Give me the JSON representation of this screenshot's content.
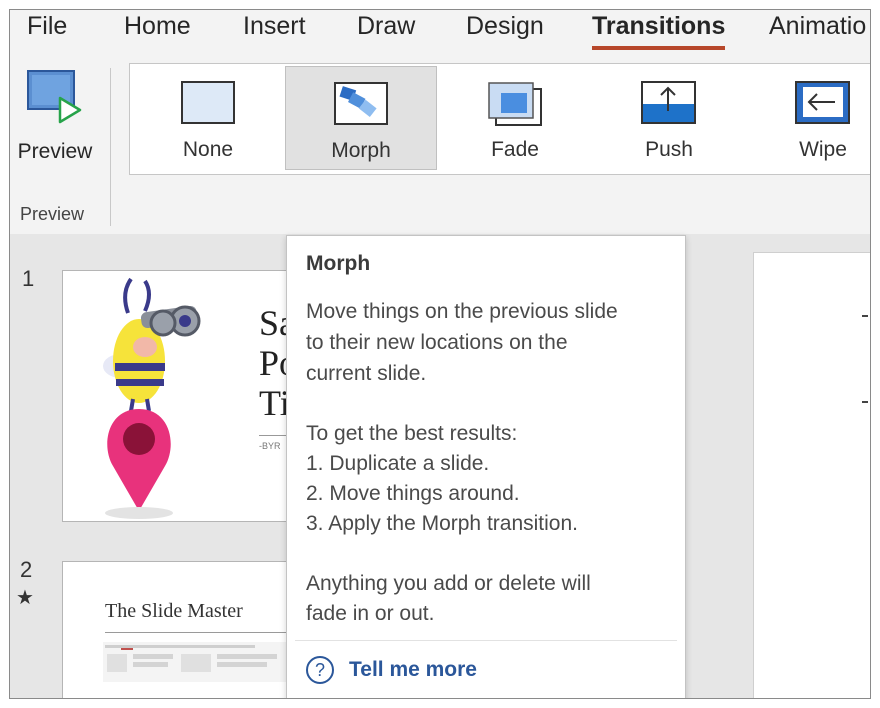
{
  "tabs": [
    {
      "label": "File",
      "active": false
    },
    {
      "label": "Home",
      "active": false
    },
    {
      "label": "Insert",
      "active": false
    },
    {
      "label": "Draw",
      "active": false
    },
    {
      "label": "Design",
      "active": false
    },
    {
      "label": "Transitions",
      "active": true
    },
    {
      "label": "Animatio",
      "active": false
    }
  ],
  "ribbon": {
    "preview_label": "Preview",
    "preview_group_label": "Preview",
    "transitions": [
      {
        "label": "None",
        "icon": "none-transition-icon",
        "selected": false
      },
      {
        "label": "Morph",
        "icon": "morph-transition-icon",
        "selected": true
      },
      {
        "label": "Fade",
        "icon": "fade-transition-icon",
        "selected": false
      },
      {
        "label": "Push",
        "icon": "push-transition-icon",
        "selected": false
      },
      {
        "label": "Wipe",
        "icon": "wipe-transition-icon",
        "selected": false
      }
    ]
  },
  "slides": [
    {
      "number": "1",
      "title_fragments": [
        "Sa",
        "Po",
        "Ti"
      ],
      "byline": "-BYR"
    },
    {
      "number": "2",
      "star": "★",
      "title": "The Slide Master"
    }
  ],
  "tooltip": {
    "title": "Morph",
    "lines": [
      "Move things on the previous slide",
      "to their new locations on the",
      "current slide.",
      "",
      "To get the best results:",
      "1. Duplicate a slide.",
      "2. Move things around.",
      "3. Apply the Morph transition.",
      "",
      "Anything you add or delete will",
      "fade in or out."
    ],
    "help_icon": "?",
    "help_label": "Tell me more"
  },
  "colors": {
    "accent_underline": "#b7472a",
    "link": "#2b579a",
    "ribbon_bg": "#f3f3f3",
    "pin": "#e8327c"
  }
}
